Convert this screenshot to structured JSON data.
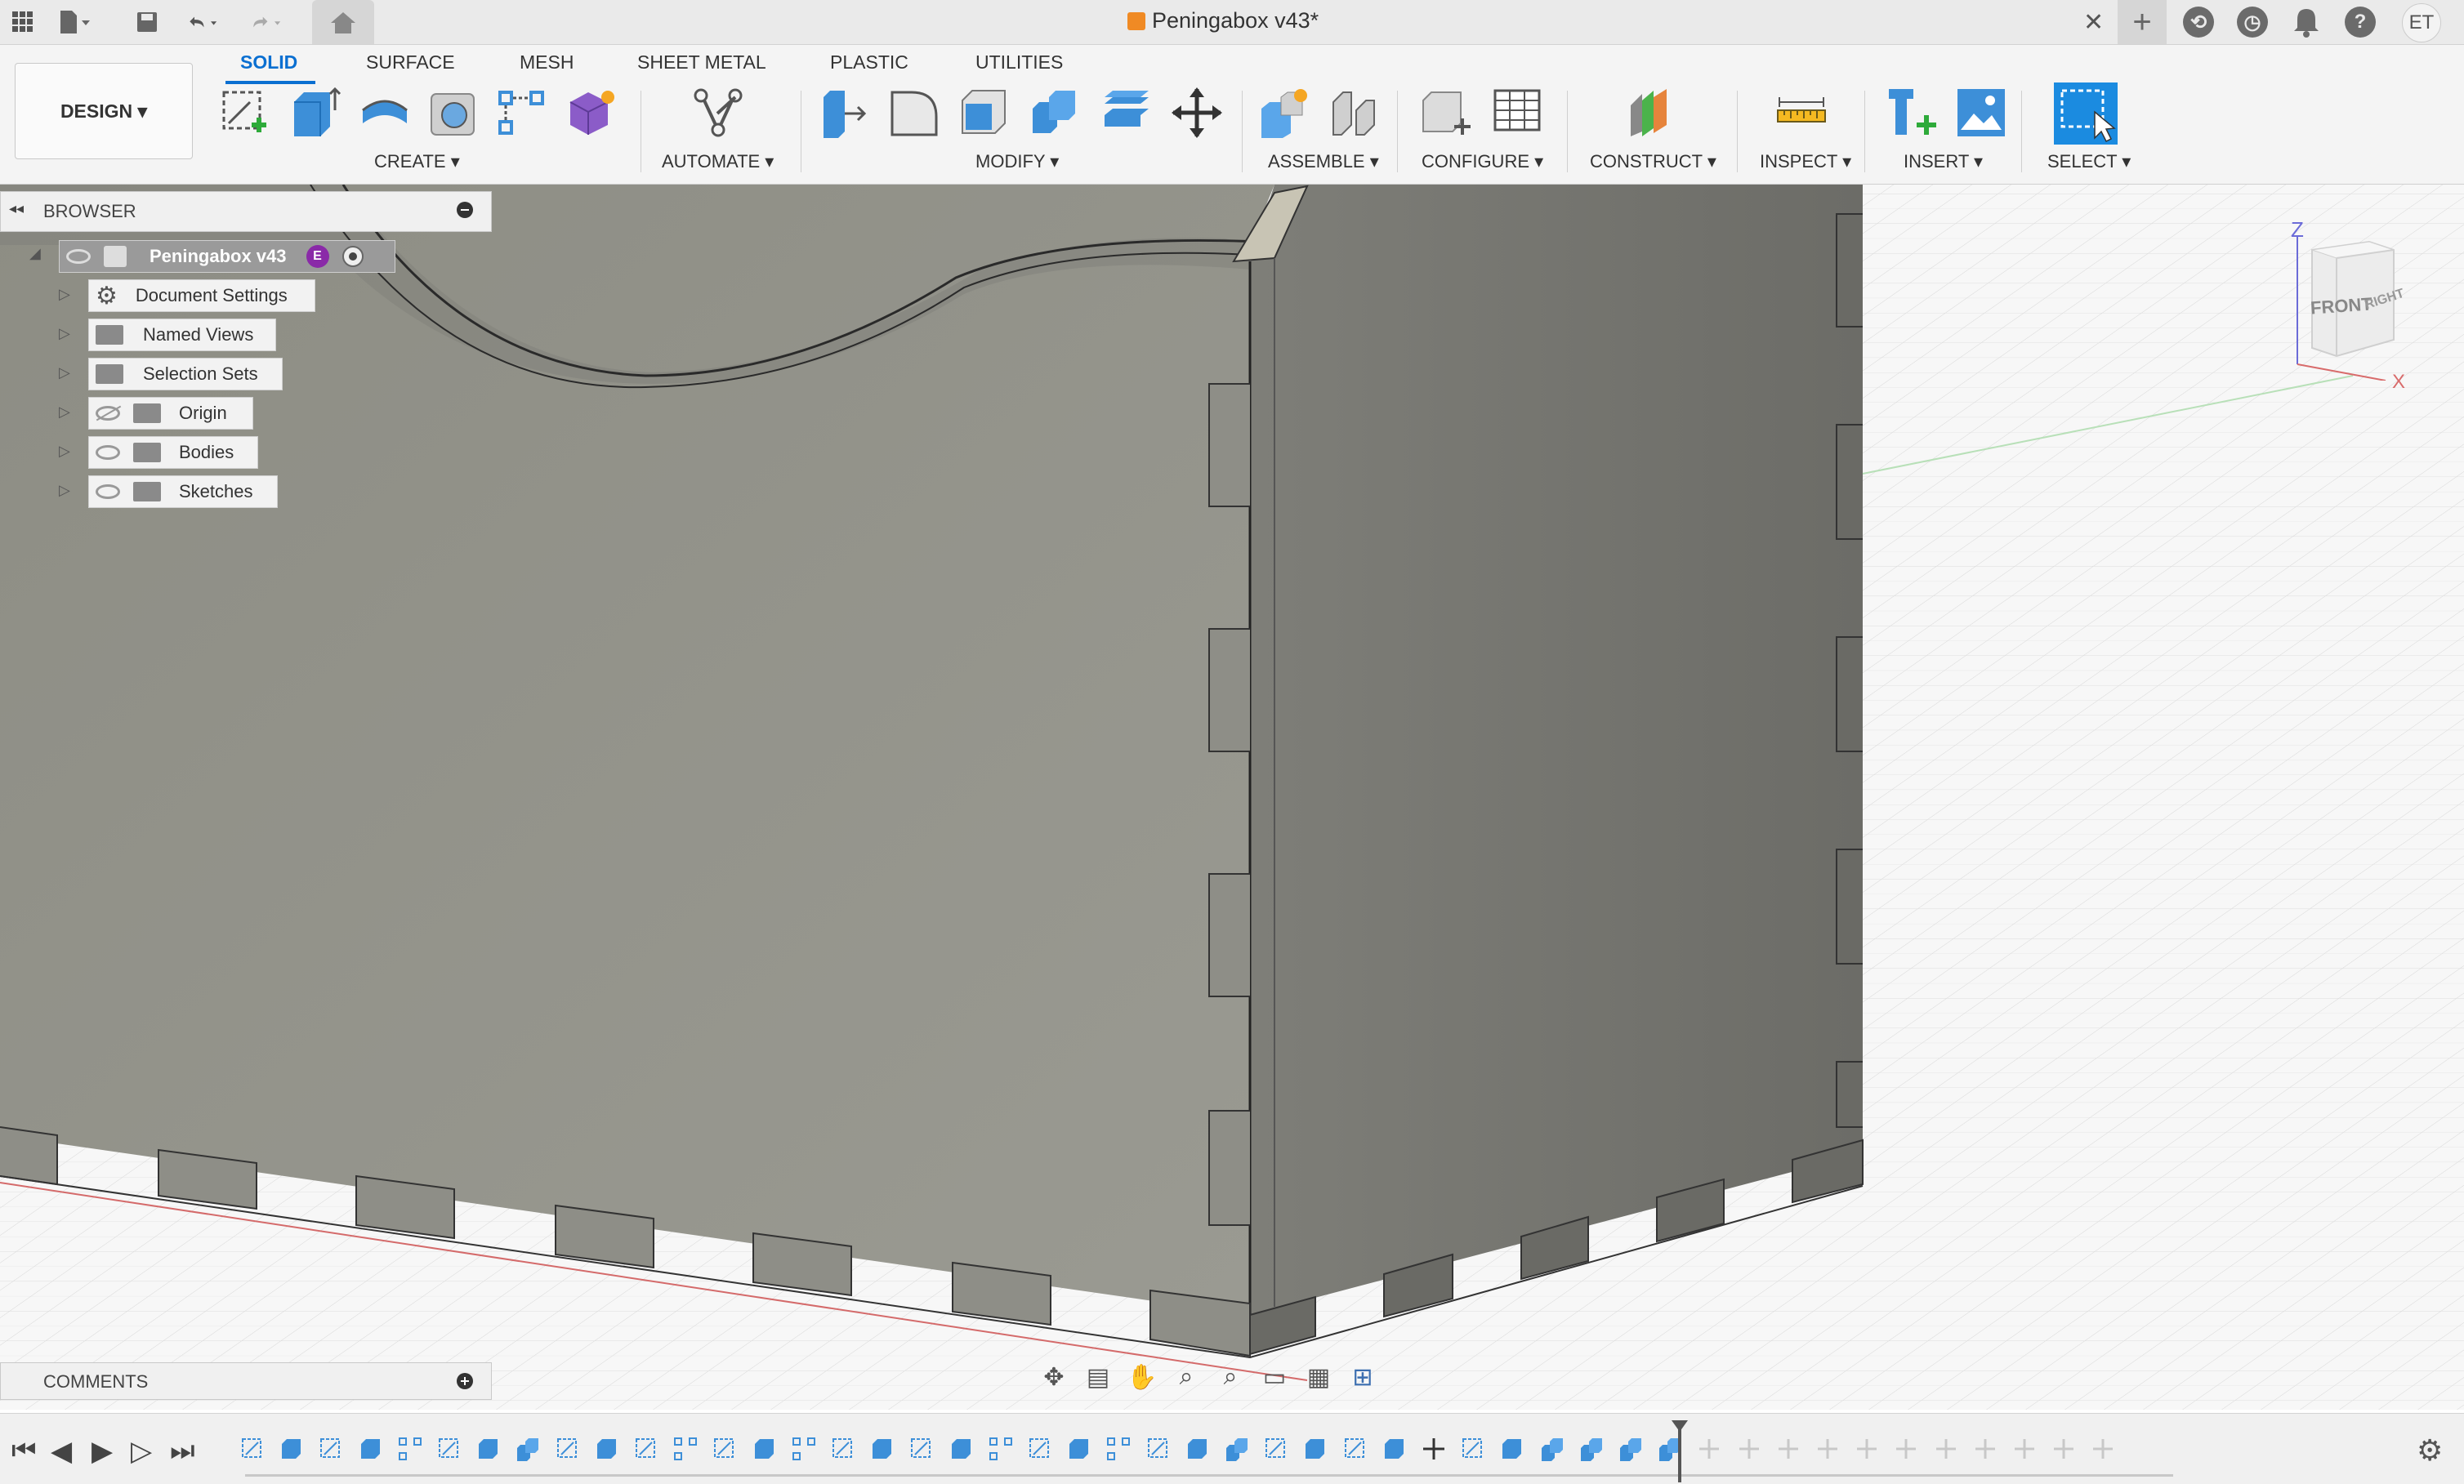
{
  "title_bar": {
    "doc_title": "Peningabox v43*",
    "close": "✕",
    "new_tab": "+",
    "avatar": "ET",
    "help": "?"
  },
  "toolbar": {
    "design": "DESIGN ▾",
    "tabs": [
      "SOLID",
      "SURFACE",
      "MESH",
      "SHEET METAL",
      "PLASTIC",
      "UTILITIES"
    ],
    "groups": [
      "CREATE ▾",
      "AUTOMATE ▾",
      "MODIFY ▾",
      "ASSEMBLE ▾",
      "CONFIGURE ▾",
      "CONSTRUCT ▾",
      "INSPECT ▾",
      "INSERT ▾",
      "SELECT ▾"
    ]
  },
  "browser": {
    "title": "BROWSER",
    "root": "Peningabox v43",
    "items": [
      {
        "label": "Document Settings"
      },
      {
        "label": "Named Views"
      },
      {
        "label": "Selection Sets"
      },
      {
        "label": "Origin"
      },
      {
        "label": "Bodies"
      },
      {
        "label": "Sketches"
      }
    ]
  },
  "comments": {
    "title": "COMMENTS"
  },
  "viewcube": {
    "front": "FRONT",
    "right": "RIGHT",
    "z": "Z",
    "x": "X"
  },
  "colors": {
    "accent": "#0a6fd1",
    "body_face": "#8f8f86",
    "body_side": "#767670",
    "grid": "#e3e3e3"
  },
  "icons": [
    "apps-grid-icon",
    "file-icon",
    "save-icon",
    "undo-icon",
    "redo-icon",
    "home-icon",
    "extensions-icon",
    "history-icon",
    "bell-icon",
    "help-icon"
  ]
}
